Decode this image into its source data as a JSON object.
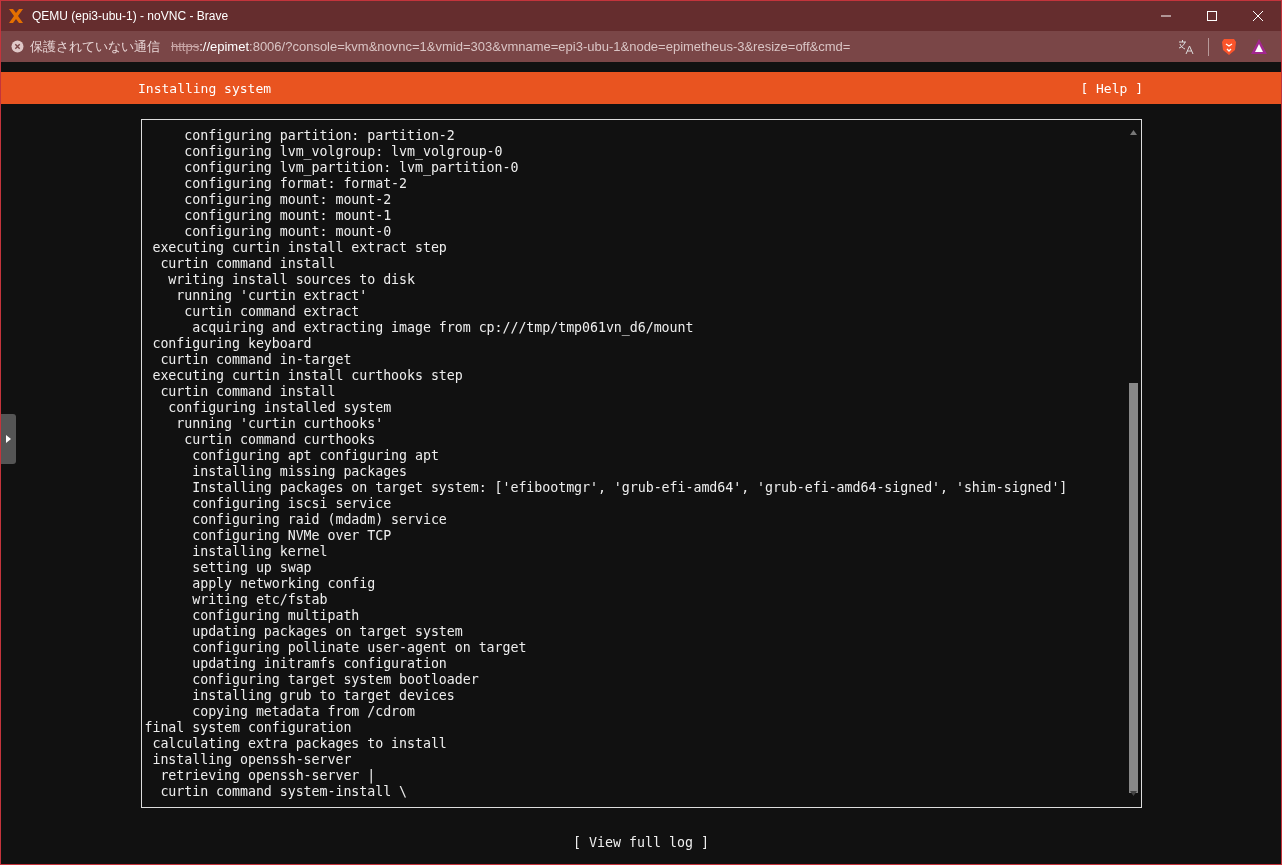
{
  "window": {
    "title": "QEMU (epi3-ubu-1) - noVNC - Brave"
  },
  "address_bar": {
    "security_label": "保護されていない通信",
    "url_scheme": "https",
    "url_host": "://epimet",
    "url_rest": ":8006/?console=kvm&novnc=1&vmid=303&vmname=epi3-ubu-1&node=epimetheus-3&resize=off&cmd="
  },
  "header": {
    "title": "Installing system",
    "help": "[ Help ]"
  },
  "log_lines": [
    "     configuring partition: partition-2",
    "     configuring lvm_volgroup: lvm_volgroup-0",
    "     configuring lvm_partition: lvm_partition-0",
    "     configuring format: format-2",
    "     configuring mount: mount-2",
    "     configuring mount: mount-1",
    "     configuring mount: mount-0",
    " executing curtin install extract step",
    "  curtin command install",
    "   writing install sources to disk",
    "    running 'curtin extract'",
    "     curtin command extract",
    "      acquiring and extracting image from cp:///tmp/tmp061vn_d6/mount",
    " configuring keyboard",
    "  curtin command in-target",
    " executing curtin install curthooks step",
    "  curtin command install",
    "   configuring installed system",
    "    running 'curtin curthooks'",
    "     curtin command curthooks",
    "      configuring apt configuring apt",
    "      installing missing packages",
    "      Installing packages on target system: ['efibootmgr', 'grub-efi-amd64', 'grub-efi-amd64-signed', 'shim-signed']",
    "      configuring iscsi service",
    "      configuring raid (mdadm) service",
    "      configuring NVMe over TCP",
    "      installing kernel",
    "      setting up swap",
    "      apply networking config",
    "      writing etc/fstab",
    "      configuring multipath",
    "      updating packages on target system",
    "      configuring pollinate user-agent on target",
    "      updating initramfs configuration",
    "      configuring target system bootloader",
    "      installing grub to target devices",
    "      copying metadata from /cdrom",
    "final system configuration",
    " calculating extra packages to install",
    " installing openssh-server",
    "  retrieving openssh-server |",
    "  curtin command system-install \\"
  ],
  "footer": {
    "view_log": "[ View full log ]"
  }
}
